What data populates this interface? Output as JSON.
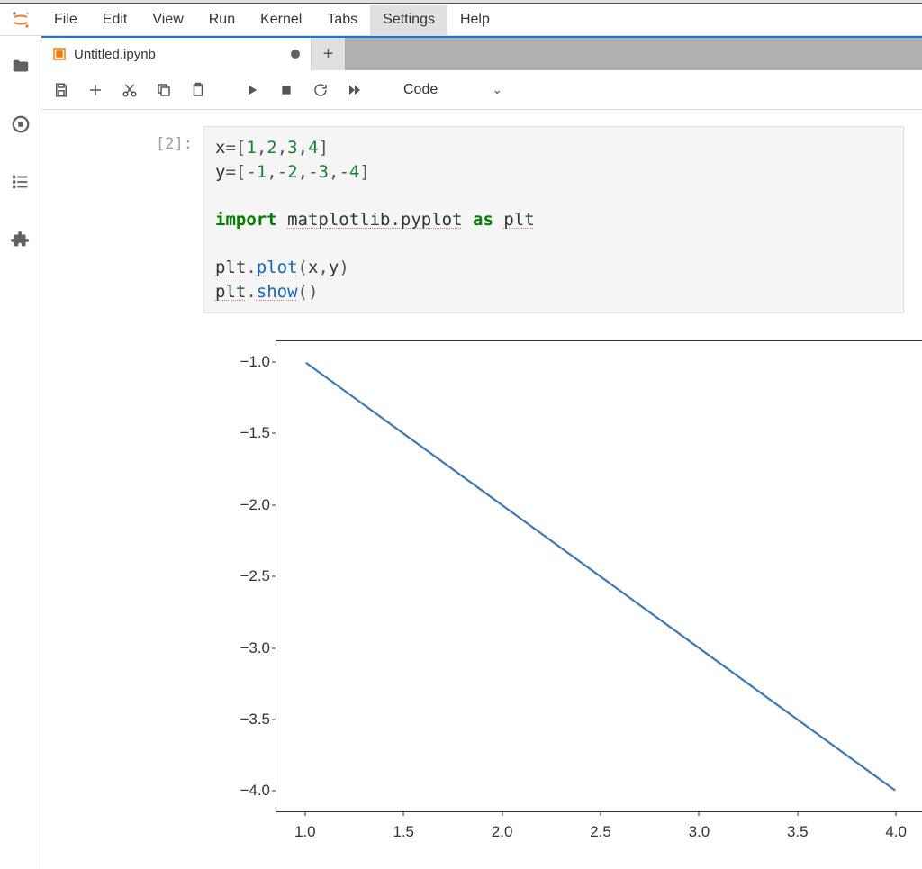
{
  "menubar": {
    "items": [
      "File",
      "Edit",
      "View",
      "Run",
      "Kernel",
      "Tabs",
      "Settings",
      "Help"
    ],
    "active_index": 6
  },
  "sidebar": {
    "icons": [
      "folder-icon",
      "running-icon",
      "toc-icon",
      "extension-icon"
    ]
  },
  "tab": {
    "title": "Untitled.ipynb",
    "dirty": true
  },
  "toolbar": {
    "buttons": [
      "save-icon",
      "add-icon",
      "cut-icon",
      "copy-icon",
      "paste-icon",
      "run-icon",
      "stop-icon",
      "restart-icon",
      "fast-forward-icon"
    ],
    "celltype_label": "Code"
  },
  "cell": {
    "exec_count": "[2]:",
    "code": {
      "l1": {
        "v": "x",
        "eq": "=",
        "br1": "[",
        "n1": "1",
        "c": ",",
        "n2": "2",
        "n3": "3",
        "n4": "4",
        "br2": "]"
      },
      "l2": {
        "v": "y",
        "eq": "=",
        "br1": "[",
        "m": "-",
        "n1": "1",
        "c": ",",
        "n2": "2",
        "n3": "3",
        "n4": "4",
        "br2": "]"
      },
      "l4": {
        "imp": "import",
        "mod": "matplotlib.pyplot",
        "as": "as",
        "alias": "plt"
      },
      "l6": {
        "obj": "plt",
        "dot": ".",
        "fn": "plot",
        "lp": "(",
        "a1": "x",
        "c": ",",
        "a2": "y",
        "rp": ")"
      },
      "l7": {
        "obj": "plt",
        "dot": ".",
        "fn": "show",
        "lp": "(",
        "rp": ")"
      }
    }
  },
  "chart_data": {
    "type": "line",
    "x": [
      1,
      2,
      3,
      4
    ],
    "y": [
      -1,
      -2,
      -3,
      -4
    ],
    "xlabel": "",
    "ylabel": "",
    "title": "",
    "xlim": [
      0.85,
      4.15
    ],
    "ylim": [
      -4.15,
      -0.85
    ],
    "xticks": [
      1.0,
      1.5,
      2.0,
      2.5,
      3.0,
      3.5,
      4.0
    ],
    "yticks": [
      -1.0,
      -1.5,
      -2.0,
      -2.5,
      -3.0,
      -3.5,
      -4.0
    ],
    "xtick_labels": [
      "1.0",
      "1.5",
      "2.0",
      "2.5",
      "3.0",
      "3.5",
      "4.0"
    ],
    "ytick_labels": [
      "−1.0",
      "−1.5",
      "−2.0",
      "−2.5",
      "−3.0",
      "−3.5",
      "−4.0"
    ],
    "line_color": "#3b78b5"
  }
}
